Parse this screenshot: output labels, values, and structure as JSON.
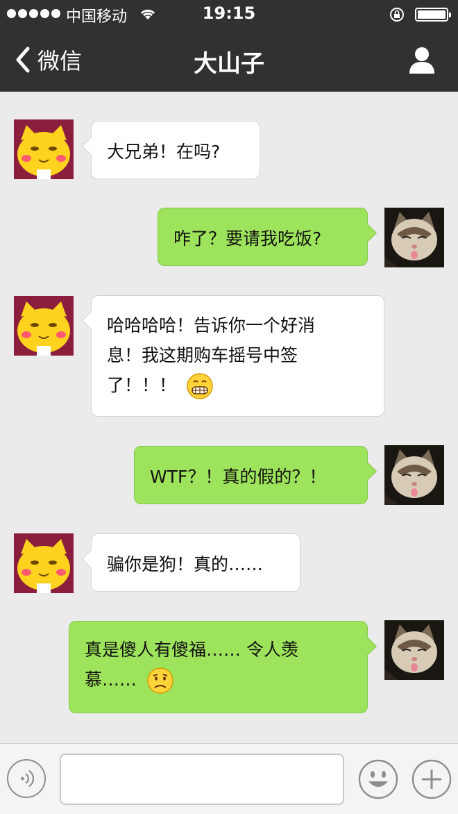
{
  "status_bar": {
    "carrier": "中国移动",
    "time": "19:15"
  },
  "nav": {
    "back_label": "微信",
    "title": "大山子"
  },
  "messages": [
    {
      "side": "left",
      "text": "大兄弟！在吗?"
    },
    {
      "side": "right",
      "text": "咋了？要请我吃饭?"
    },
    {
      "side": "left",
      "lines": [
        "哈哈哈哈！告诉你一个好消",
        "息！我这期购车摇号中签",
        "了！！！"
      ],
      "emoji": "grinning-emoji"
    },
    {
      "side": "right",
      "text": "WTF？！真的假的？！"
    },
    {
      "side": "left",
      "text": "骗你是狗！真的……"
    },
    {
      "side": "right",
      "lines": [
        "真是傻人有傻福…… 令人羡",
        "慕……"
      ],
      "emoji": "frowning-emoji"
    }
  ],
  "input": {
    "value": ""
  },
  "colors": {
    "navbar": "#2f3133",
    "chat_background": "#ebebeb",
    "bubble_sent": "#9de35b",
    "bubble_received": "#ffffff"
  }
}
